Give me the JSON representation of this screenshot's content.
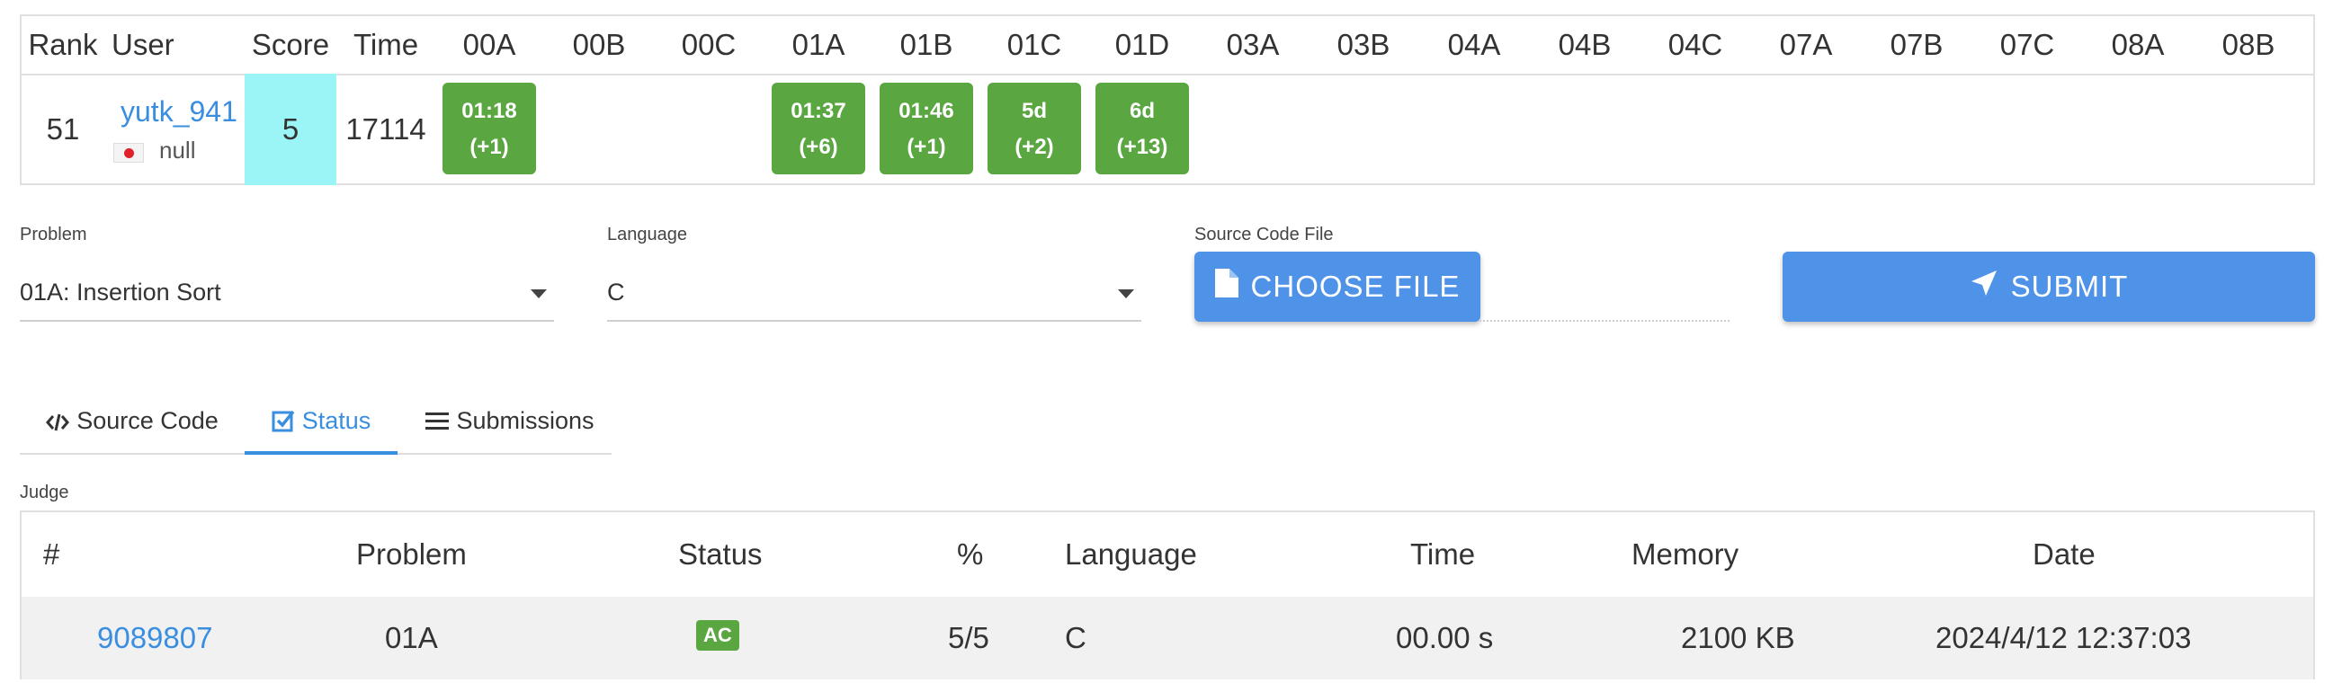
{
  "standings": {
    "headers": {
      "rank": "Rank",
      "user": "User",
      "score": "Score",
      "time": "Time",
      "problems": [
        "00A",
        "00B",
        "00C",
        "01A",
        "01B",
        "01C",
        "01D",
        "03A",
        "03B",
        "04A",
        "04B",
        "04C",
        "07A",
        "07B",
        "07C",
        "08A",
        "08B"
      ]
    },
    "row": {
      "rank": "51",
      "user": "yutk_941",
      "affiliation": "null",
      "flag_icon": "japan-flag-icon",
      "score": "5",
      "time": "17114",
      "cells": {
        "00A": {
          "time": "01:18",
          "penalty": "(+1)"
        },
        "01A": {
          "time": "01:37",
          "penalty": "(+6)"
        },
        "01B": {
          "time": "01:46",
          "penalty": "(+1)"
        },
        "01C": {
          "time": "5d",
          "penalty": "(+2)"
        },
        "01D": {
          "time": "6d",
          "penalty": "(+13)"
        }
      }
    }
  },
  "form": {
    "problem_label": "Problem",
    "problem_value": "01A: Insertion Sort",
    "language_label": "Language",
    "language_value": "C",
    "file_label": "Source Code File",
    "choose_file": "CHOOSE FILE",
    "submit": "SUBMIT"
  },
  "tabs": {
    "source": "Source Code",
    "status": "Status",
    "submissions": "Submissions"
  },
  "judge": {
    "label": "Judge",
    "headers": {
      "num": "#",
      "problem": "Problem",
      "status": "Status",
      "percent": "%",
      "language": "Language",
      "time": "Time",
      "memory": "Memory",
      "date": "Date"
    },
    "row": {
      "num": "9089807",
      "problem": "01A",
      "status": "AC",
      "percent": "5/5",
      "language": "C",
      "time": "00.00 s",
      "memory": "2100 KB",
      "date": "2024/4/12 12:37:03"
    }
  },
  "colors": {
    "accent": "#3a8ee0",
    "button": "#4e93e8",
    "accepted": "#5aa641",
    "score_highlight": "#9bf5f7"
  }
}
